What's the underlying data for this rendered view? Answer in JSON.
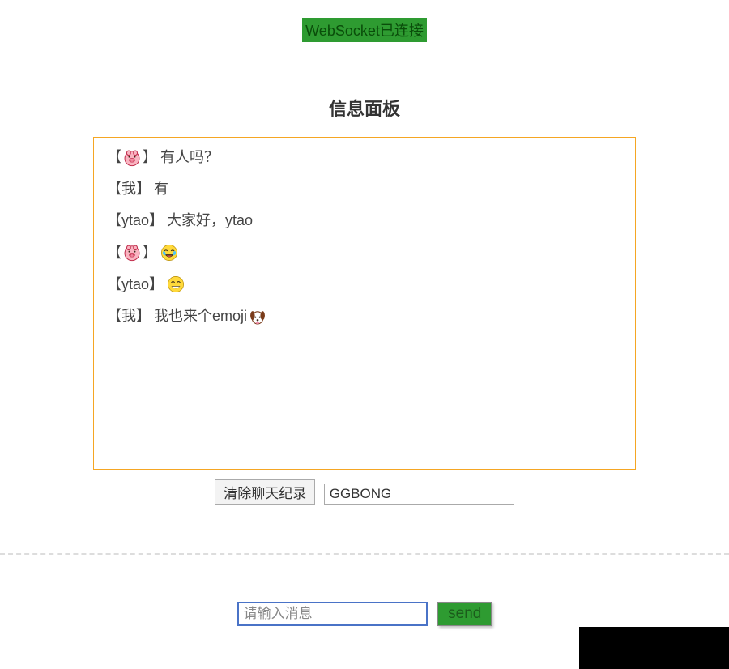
{
  "status": {
    "text": "WebSocket已连接"
  },
  "panel": {
    "title": "信息面板"
  },
  "messages": [
    {
      "sender_type": "pig",
      "sender": "🐷",
      "text": "有人吗？"
    },
    {
      "sender_type": "text",
      "sender": "我",
      "text": "有"
    },
    {
      "sender_type": "text",
      "sender": "ytao",
      "text": "大家好，ytao"
    },
    {
      "sender_type": "pig",
      "sender": "🐷",
      "text": "😂"
    },
    {
      "sender_type": "text",
      "sender": "ytao",
      "text": "😄"
    },
    {
      "sender_type": "text",
      "sender": "我",
      "text": "我也来个emoji 🐶"
    }
  ],
  "controls": {
    "clear_label": "清除聊天纪录",
    "name_value": "GGBONG"
  },
  "input": {
    "placeholder": "请输入消息",
    "send_label": "send"
  },
  "icons": {
    "pig": "pig-icon",
    "laugh_cry": "laugh-cry-icon",
    "smile": "smile-icon",
    "dog": "dog-icon"
  }
}
